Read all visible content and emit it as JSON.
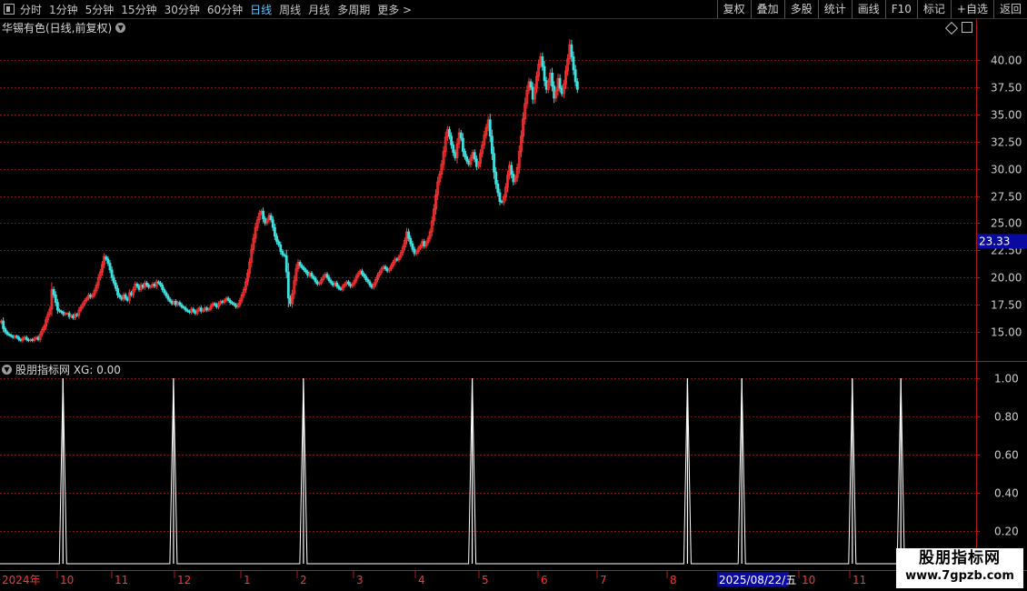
{
  "toolbar": {
    "periods": [
      "分时",
      "1分钟",
      "5分钟",
      "15分钟",
      "30分钟",
      "60分钟",
      "日线",
      "周线",
      "月线",
      "多周期",
      "更多 >"
    ],
    "active_period": "日线",
    "buttons": [
      "复权",
      "叠加",
      "多股",
      "统计",
      "画线",
      "F10",
      "标记",
      "+自选",
      "返回"
    ]
  },
  "stock_title": "华锡有色(日线,前复权)",
  "indicator_title": "股朋指标网 XG: 0.00",
  "price_badge": "23.33",
  "date_badge": "2025/08/22/五",
  "watermark": {
    "line1": "股朋指标网",
    "line2": "www.7gpzb.com"
  },
  "colors": {
    "up": "#ff3333",
    "down": "#3fe0e0",
    "grid": "#7a1010",
    "axis": "#b01818",
    "badge": "#0a0aa0",
    "signal": "#ffffff"
  },
  "chart_data": [
    {
      "type": "candlestick",
      "title": "华锡有色(日线,前复权)",
      "y_ticks": [
        40.0,
        37.5,
        35.0,
        32.5,
        30.0,
        27.5,
        25.0,
        22.5,
        20.0,
        17.5,
        15.0
      ],
      "ylim": [
        13.6,
        42.9
      ],
      "current_price": 23.33,
      "x_labels": [
        "2024年",
        "10",
        "11",
        "12",
        "1",
        "2",
        "3",
        "4",
        "5",
        "6",
        "7",
        "8",
        "2025/08/22/五",
        "10",
        "11"
      ],
      "grid": true,
      "approx_close": [
        16.0,
        15.3,
        15.0,
        14.8,
        14.7,
        14.6,
        14.5,
        14.6,
        14.5,
        14.3,
        14.2,
        14.4,
        14.5,
        14.3,
        14.2,
        14.3,
        14.2,
        14.4,
        14.5,
        14.3,
        14.8,
        15.2,
        15.5,
        16.1,
        16.6,
        17.1,
        18.9,
        18.4,
        17.7,
        17.0,
        16.9,
        16.8,
        16.6,
        16.7,
        16.7,
        16.4,
        16.5,
        16.3,
        16.6,
        16.5,
        17.0,
        17.3,
        17.6,
        17.9,
        18.1,
        18.4,
        18.2,
        18.4,
        18.8,
        19.3,
        20.0,
        20.5,
        21.2,
        21.9,
        21.7,
        21.3,
        20.7,
        20.0,
        19.5,
        19.0,
        18.4,
        18.2,
        18.0,
        18.4,
        18.1,
        17.9,
        18.6,
        18.4,
        18.9,
        19.4,
        19.2,
        18.9,
        19.3,
        19.1,
        19.5,
        19.3,
        19.1,
        19.2,
        19.4,
        19.2,
        19.6,
        19.5,
        19.3,
        18.9,
        18.6,
        18.3,
        18.0,
        17.8,
        17.6,
        17.8,
        17.5,
        17.7,
        17.5,
        17.3,
        17.2,
        17.0,
        16.9,
        16.8,
        17.1,
        16.9,
        16.7,
        17.0,
        17.2,
        16.9,
        17.0,
        17.2,
        17.0,
        17.1,
        17.4,
        17.6,
        17.5,
        17.3,
        17.6,
        17.8,
        17.7,
        17.9,
        18.1,
        17.9,
        17.7,
        17.6,
        17.5,
        17.3,
        17.5,
        17.9,
        18.4,
        18.9,
        19.6,
        20.4,
        21.4,
        22.6,
        23.6,
        24.6,
        25.3,
        25.9,
        26.1,
        25.4,
        25.0,
        25.3,
        25.7,
        25.3,
        24.6,
        23.8,
        23.3,
        23.0,
        22.4,
        22.1,
        22.0,
        20.5,
        18.1,
        17.6,
        18.5,
        19.7,
        20.8,
        21.4,
        21.1,
        20.9,
        20.7,
        20.5,
        20.2,
        20.4,
        20.1,
        19.9,
        19.6,
        19.4,
        19.5,
        19.8,
        20.1,
        20.3,
        20.0,
        19.7,
        19.5,
        19.3,
        19.5,
        19.2,
        19.0,
        18.9,
        19.2,
        19.4,
        19.6,
        19.4,
        19.2,
        19.4,
        19.7,
        20.1,
        20.4,
        20.6,
        20.3,
        20.1,
        19.8,
        19.6,
        19.3,
        19.1,
        19.4,
        19.8,
        20.2,
        20.5,
        20.8,
        21.0,
        20.8,
        20.6,
        20.8,
        21.1,
        21.4,
        21.7,
        21.6,
        21.9,
        22.3,
        22.8,
        23.4,
        24.2,
        23.6,
        23.1,
        22.6,
        22.2,
        22.4,
        22.7,
        22.9,
        23.3,
        22.9,
        23.2,
        23.6,
        24.2,
        25.2,
        26.3,
        27.6,
        28.8,
        29.5,
        30.4,
        31.6,
        32.9,
        33.6,
        33.0,
        32.2,
        31.5,
        31.0,
        32.3,
        33.3,
        32.8,
        31.6,
        31.1,
        30.7,
        30.4,
        31.0,
        31.5,
        30.9,
        30.2,
        30.5,
        31.4,
        32.2,
        33.1,
        33.8,
        34.5,
        33.0,
        31.4,
        29.7,
        28.6,
        27.8,
        27.0,
        26.9,
        27.4,
        28.3,
        29.4,
        30.3,
        29.5,
        28.8,
        29.2,
        30.1,
        31.6,
        33.0,
        34.6,
        36.0,
        37.2,
        38.0,
        37.5,
        36.4,
        37.4,
        38.5,
        39.6,
        40.3,
        39.4,
        38.1,
        37.3,
        38.0,
        38.8,
        37.6,
        36.5,
        37.2,
        38.3,
        37.4,
        36.9,
        37.8,
        39.0,
        40.1,
        41.4,
        40.3,
        39.1,
        38.0,
        37.3
      ]
    },
    {
      "type": "line",
      "title": "股朋指标网",
      "series": [
        {
          "name": "XG",
          "value": 0.0
        }
      ],
      "y_ticks": [
        1.0,
        0.8,
        0.6,
        0.4,
        0.2
      ],
      "ylim": [
        0,
        1.05
      ],
      "signal_bars": [
        32,
        89,
        156,
        243,
        354,
        382,
        439,
        464
      ]
    }
  ]
}
